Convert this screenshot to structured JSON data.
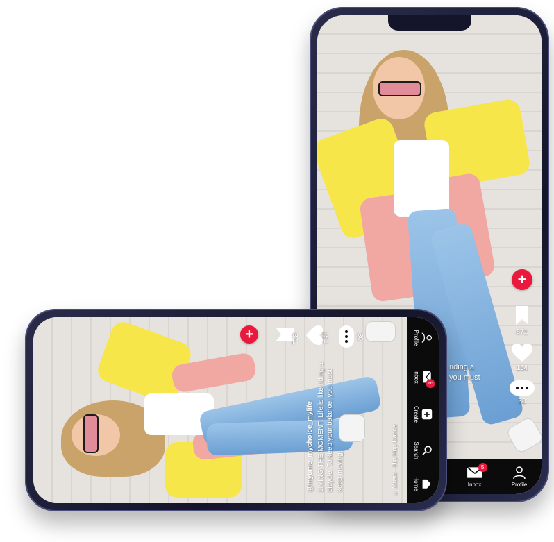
{
  "post": {
    "username": "@mytime_mychoice_mylife",
    "caption_line1": "LIVING THE MOMENT. Life is like riding a",
    "caption_line2": "bicycle. To keep your balance, you must",
    "caption_line3": "keep moving.",
    "music": "Music - Hip Hop Dance"
  },
  "portrait": {
    "caption_fragment_1": "riding a",
    "caption_fragment_2": "you must",
    "bookmarks": "871",
    "likes": "154",
    "comments": "30"
  },
  "landscape": {
    "bookmarks": "871",
    "likes": "154",
    "comments": "30"
  },
  "nav": {
    "home": "Home",
    "search": "Search",
    "create": "Create",
    "inbox": "Inbox",
    "inbox_badge": "5",
    "profile": "Profile"
  },
  "colors": {
    "accent": "#e8193c",
    "nav_bg": "#0b0b0b",
    "phone_frame": "#1f2140"
  },
  "icons": {
    "plus": "plus-icon",
    "bookmark": "bookmark-icon",
    "heart": "heart-icon",
    "comment": "comment-icon",
    "home": "home-icon",
    "search": "search-icon",
    "create": "create-icon",
    "inbox": "envelope-icon",
    "profile": "profile-icon",
    "music": "music-note-icon"
  }
}
